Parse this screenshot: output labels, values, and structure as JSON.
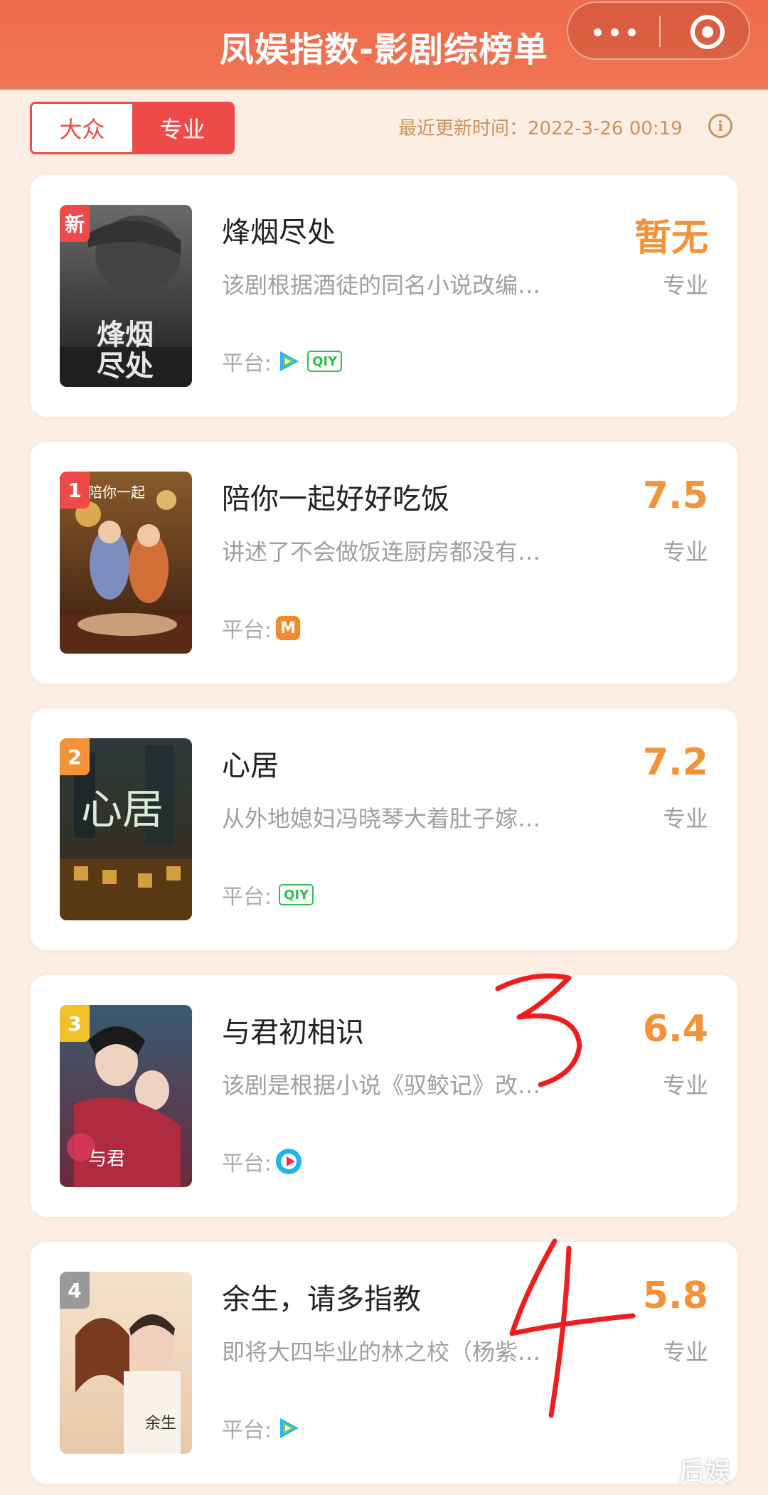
{
  "header": {
    "title": "凤娱指数-影剧综榜单"
  },
  "toggle": {
    "options": [
      "大众",
      "专业"
    ],
    "active": "专业"
  },
  "update": {
    "label": "最近更新时间：2022-3-26 00:19"
  },
  "items": [
    {
      "badge": "新",
      "badge_color": "#ef4a4a",
      "title": "烽烟尽处",
      "desc": "该剧根据酒徒的同名小说改编…",
      "platform_label": "平台:",
      "platforms": [
        "tencent-video",
        "iqiyi"
      ],
      "score": "暂无",
      "score_label": "专业",
      "poster_text": "烽烟尽处"
    },
    {
      "badge": "1",
      "badge_color": "#ef4a4a",
      "title": "陪你一起好好吃饭",
      "desc": "讲述了不会做饭连厨房都没有…",
      "platform_label": "平台:",
      "platforms": [
        "mango-tv"
      ],
      "score": "7.5",
      "score_label": "专业",
      "poster_text": "陪你一起好好吃饭"
    },
    {
      "badge": "2",
      "badge_color": "#f39237",
      "title": "心居",
      "desc": "从外地媳妇冯晓琴大着肚子嫁…",
      "platform_label": "平台:",
      "platforms": [
        "iqiyi"
      ],
      "score": "7.2",
      "score_label": "专业",
      "poster_text": "心居"
    },
    {
      "badge": "3",
      "badge_color": "#f2c029",
      "title": "与君初相识",
      "desc": "该剧是根据小说《驭鲛记》改…",
      "platform_label": "平台:",
      "platforms": [
        "youku"
      ],
      "score": "6.4",
      "score_label": "专业",
      "poster_text": "与君初相识"
    },
    {
      "badge": "4",
      "badge_color": "#9a9a9a",
      "title": "余生，请多指教",
      "desc": "即将大四毕业的林之校（杨紫…",
      "platform_label": "平台:",
      "platforms": [
        "tencent-video"
      ],
      "score": "5.8",
      "score_label": "专业",
      "poster_text": "余生"
    }
  ],
  "platform_logos": {
    "iqiyi": "QIY",
    "mango": "M"
  },
  "annotations": [
    "3",
    "4"
  ],
  "watermark": "后娱",
  "colors": {
    "header": "#ee6a4c",
    "accent_red": "#ef4a4a",
    "score": "#f39237",
    "background": "#fdeee3"
  }
}
